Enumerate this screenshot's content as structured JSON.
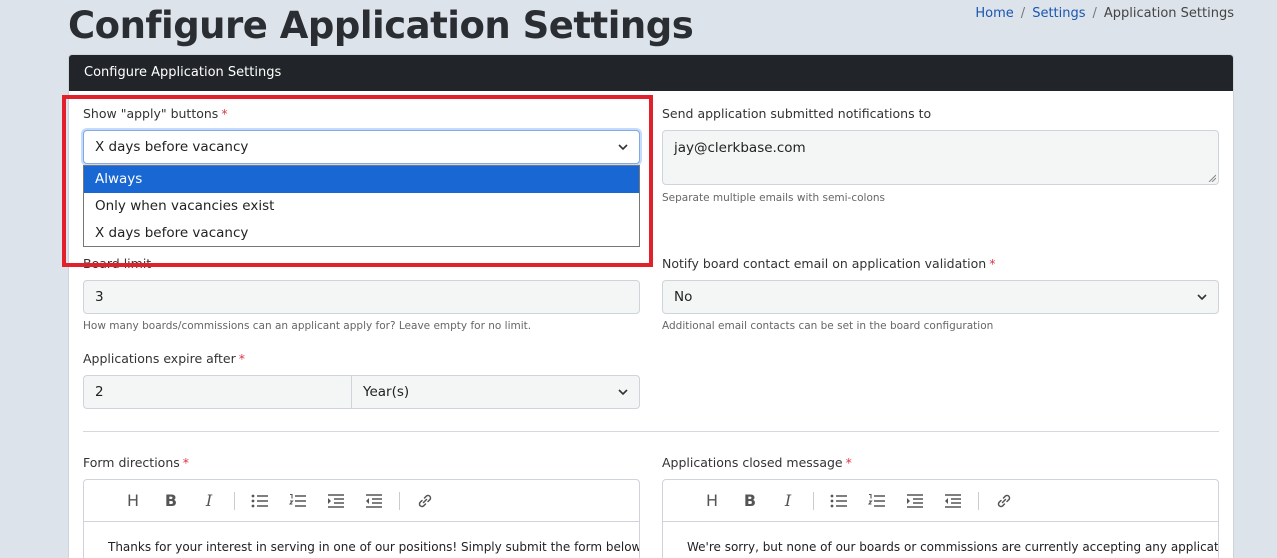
{
  "page": {
    "title": "Configure Application Settings",
    "breadcrumb": [
      "Home",
      "Settings",
      "Application Settings"
    ]
  },
  "card": {
    "header": "Configure Application Settings"
  },
  "fields": {
    "show_apply": {
      "label": "Show \"apply\" buttons",
      "value": "X days before vacancy",
      "options": [
        "Always",
        "Only when vacancies exist",
        "X days before vacancy"
      ],
      "highlighted_option": "Always"
    },
    "notify_to": {
      "label": "Send application submitted notifications to",
      "value": "jay@clerkbase.com",
      "help": "Separate multiple emails with semi-colons"
    },
    "board_limit": {
      "label": "Board limit",
      "value": "3",
      "help": "How many boards/commissions can an applicant apply for? Leave empty for no limit."
    },
    "notify_board": {
      "label": "Notify board contact email on application validation",
      "value": "No",
      "help": "Additional email contacts can be set in the board configuration"
    },
    "expire": {
      "label": "Applications expire after",
      "value": "2",
      "unit": "Year(s)"
    },
    "form_directions": {
      "label": "Form directions",
      "text": "Thanks for your interest in serving in one of our positions! Simply submit the form below and we'll"
    },
    "closed_message": {
      "label": "Applications closed message",
      "text": "We're sorry, but none of our boards or commissions are currently accepting any applications."
    }
  },
  "required_marker": "*",
  "toolbar": {
    "heading": "H",
    "bold": "B",
    "italic": "I"
  },
  "colors": {
    "header_bg": "#212529",
    "highlight": "#e0202b",
    "selected_option": "#1967d2",
    "link": "#1a56b0"
  }
}
